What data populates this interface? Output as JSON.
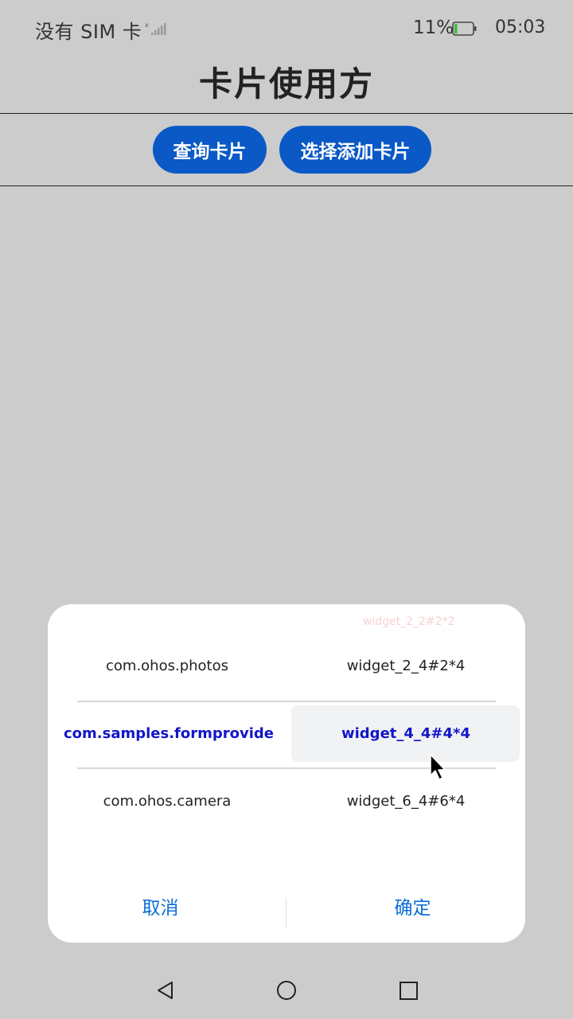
{
  "status_bar": {
    "carrier": "没有 SIM 卡",
    "battery_percent": "11%",
    "battery_level": 0.11,
    "time": "05:03"
  },
  "header": {
    "title": "卡片使用方",
    "buttons": {
      "query": "查询卡片",
      "select_add": "选择添加卡片"
    }
  },
  "dialog": {
    "faded_top_value": "widget_2_2#2*2",
    "left_column": {
      "items": [
        "com.ohos.photos",
        "com.samples.formprovide",
        "com.ohos.camera"
      ],
      "selected": "com.samples.formprovide"
    },
    "right_column": {
      "items": [
        "widget_2_4#2*4",
        "widget_4_4#4*4",
        "widget_6_4#6*4"
      ],
      "selected": "widget_4_4#4*4"
    },
    "cancel_label": "取消",
    "confirm_label": "确定"
  },
  "nav_bar": {
    "icons": [
      "back-icon",
      "home-icon",
      "recents-icon"
    ]
  },
  "colors": {
    "accent_button": "#0a59c6",
    "selected_text": "#1216c8",
    "dialog_action": "#0a6fd6",
    "background": "#cccccc"
  }
}
